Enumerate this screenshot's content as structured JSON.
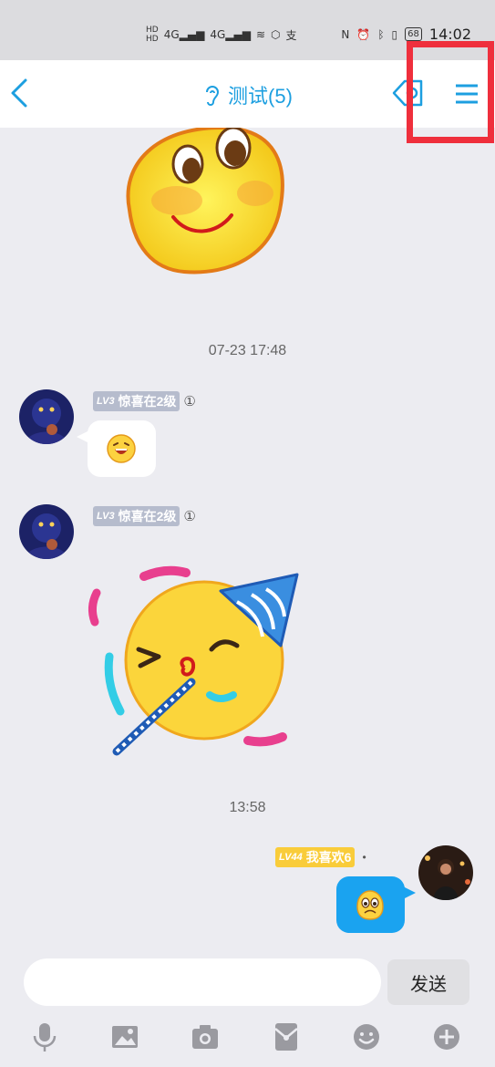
{
  "status_bar": {
    "left_icons": [
      "HD",
      "4G",
      "4G",
      "wifi",
      "hotspot",
      "alipay"
    ],
    "right_icons": [
      "nfc",
      "alarm",
      "bluetooth",
      "vibrate",
      "battery"
    ],
    "battery": "68",
    "time": "14:02"
  },
  "header": {
    "title": "测试(5)"
  },
  "messages": {
    "time1": "07-23 17:48",
    "msg1": {
      "level": "LV3",
      "name": "惊喜在2级",
      "info": "①"
    },
    "msg2": {
      "level": "LV3",
      "name": "惊喜在2级",
      "info": "①"
    },
    "time2": "13:58",
    "msg3": {
      "level": "LV44",
      "name": "我喜欢6",
      "dot": "•"
    }
  },
  "composer": {
    "input_value": "",
    "send_label": "发送"
  },
  "toolbar_icons": [
    "microphone-icon",
    "image-icon",
    "camera-icon",
    "red-packet-icon",
    "emoji-icon",
    "plus-icon"
  ],
  "colors": {
    "accent": "#1d9fe0",
    "highlight": "#ef2f3c",
    "background": "#ececf1"
  }
}
